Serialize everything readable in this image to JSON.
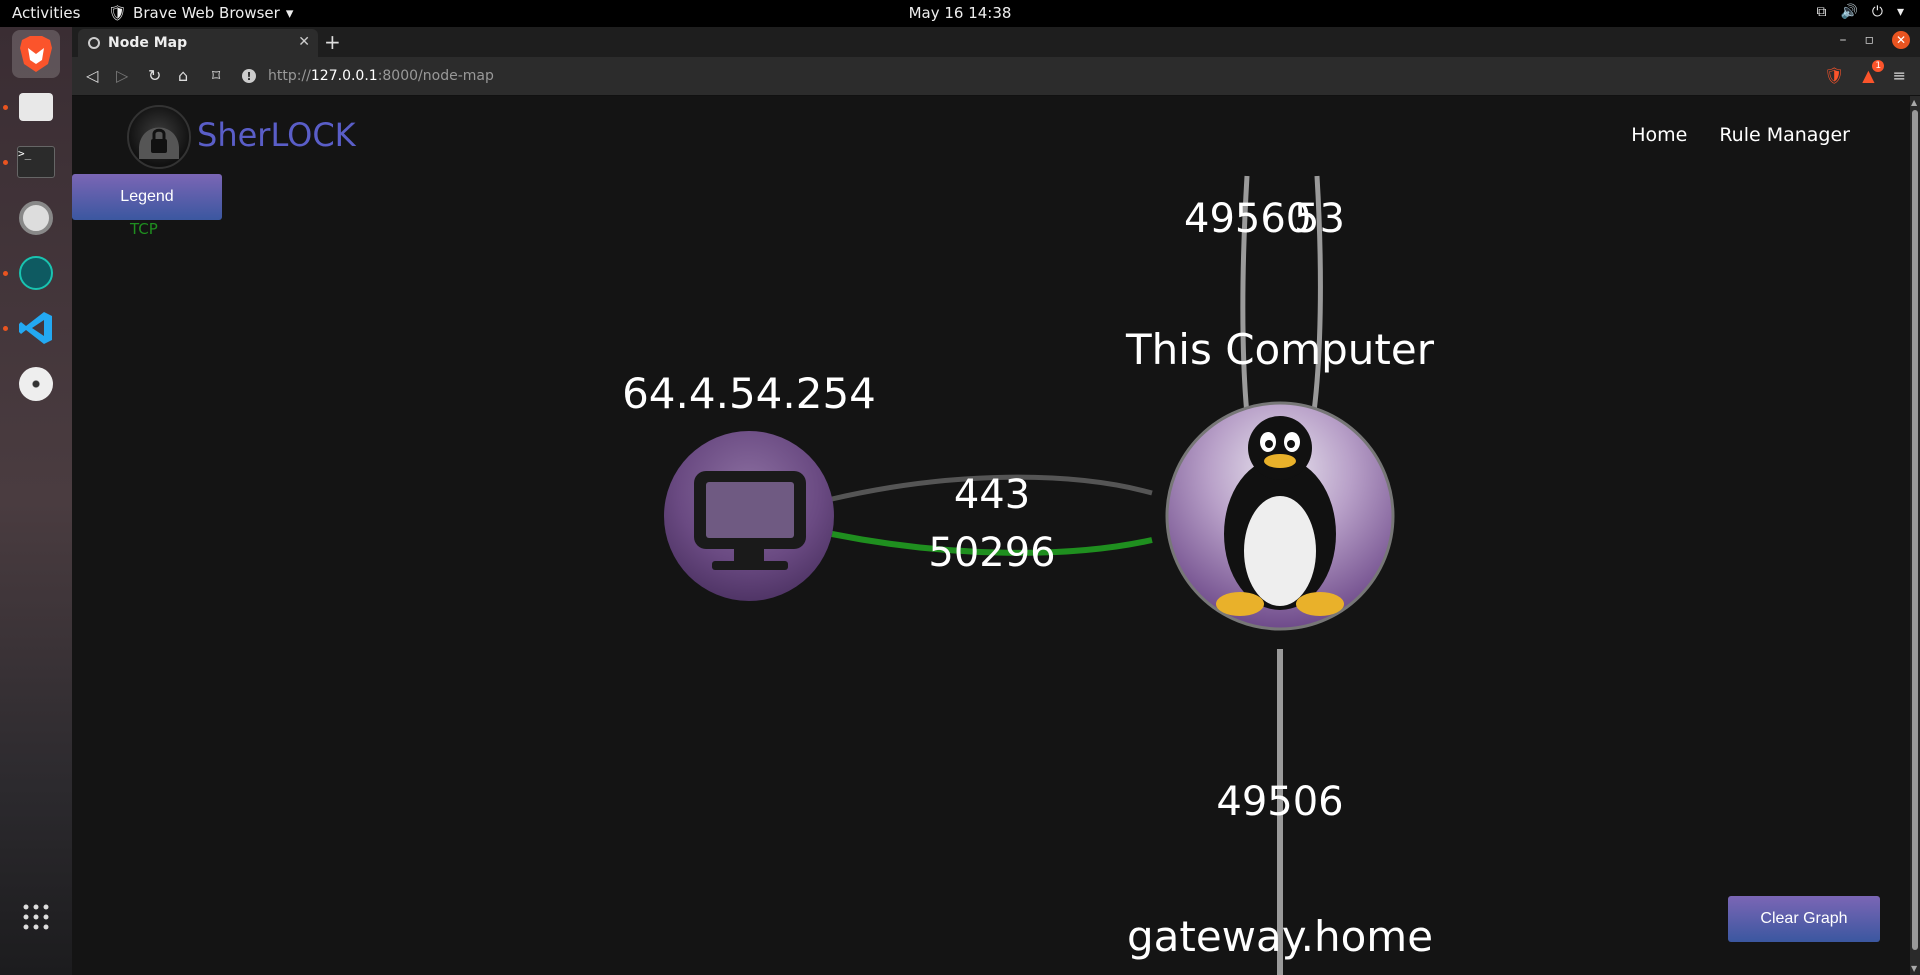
{
  "topbar": {
    "activities": "Activities",
    "app_name": "Brave Web Browser",
    "clock": "May 16  14:38"
  },
  "dock": {
    "items": [
      "brave-browser",
      "files",
      "terminal",
      "settings",
      "gitkraken",
      "vscode",
      "dvd-drive",
      "app-grid"
    ]
  },
  "browser": {
    "tab_title": "Node Map",
    "url_prefix": "http://",
    "url_host": "127.0.0.1",
    "url_rest": ":8000/node-map",
    "shields_badge": "1"
  },
  "site": {
    "brand": "SherLOCK",
    "nav": [
      "Home",
      "Rule Manager"
    ],
    "legend_button": "Legend",
    "legend_items": [
      {
        "label": "TCP",
        "color": "#1f8f1f"
      }
    ],
    "clear_button": "Clear Graph"
  },
  "graph": {
    "nodes": [
      {
        "id": "remote",
        "label": "64.4.54.254",
        "icon": "monitor-icon"
      },
      {
        "id": "local",
        "label": "This Computer",
        "icon": "tux-penguin-icon"
      },
      {
        "id": "gateway",
        "label": "gateway.home",
        "icon": "monitor-icon"
      }
    ],
    "edges": [
      {
        "from": "remote",
        "to": "local",
        "label": "443",
        "protocol": "other",
        "color": "#555555"
      },
      {
        "from": "remote",
        "to": "local",
        "label": "50296",
        "protocol": "TCP",
        "color": "#1f8f1f"
      },
      {
        "from": "local",
        "to": "offscreen",
        "label": "49560",
        "protocol": "other",
        "color": "#9a9a9a"
      },
      {
        "from": "local",
        "to": "offscreen",
        "label": "53",
        "protocol": "other",
        "color": "#9a9a9a"
      },
      {
        "from": "local",
        "to": "gateway",
        "label": "49506",
        "protocol": "other",
        "color": "#9a9a9a"
      }
    ]
  }
}
